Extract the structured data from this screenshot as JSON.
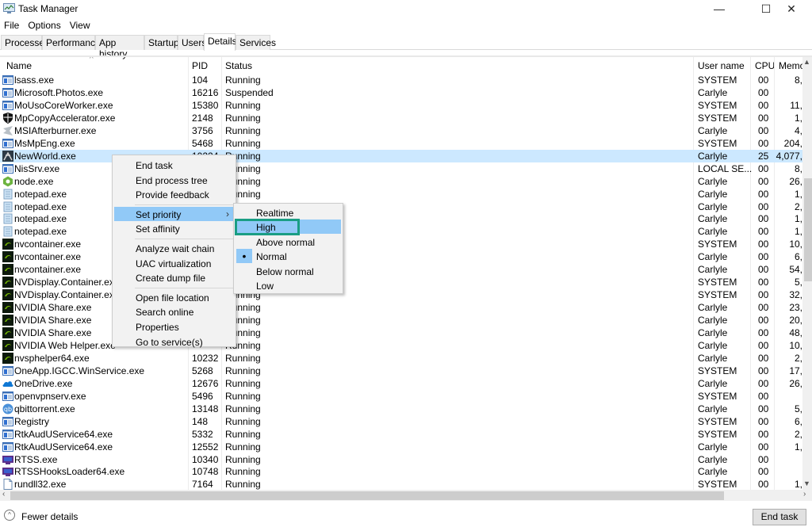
{
  "window": {
    "title": "Task Manager",
    "controls": {
      "minimize": "—",
      "maximize": "☐",
      "close": "✕"
    }
  },
  "menu": [
    "File",
    "Options",
    "View"
  ],
  "tabs": [
    {
      "label": "Processes"
    },
    {
      "label": "Performance"
    },
    {
      "label": "App history"
    },
    {
      "label": "Startup"
    },
    {
      "label": "Users"
    },
    {
      "label": "Details",
      "active": true
    },
    {
      "label": "Services"
    }
  ],
  "columns": {
    "name": "Name",
    "pid": "PID",
    "status": "Status",
    "user": "User name",
    "cpu": "CPU",
    "memory": "Memo"
  },
  "rows": [
    {
      "name": "lsass.exe",
      "icon": "service-window",
      "pid": "104",
      "status": "Running",
      "user": "SYSTEM",
      "cpu": "00",
      "mem": "8,"
    },
    {
      "name": "Microsoft.Photos.exe",
      "icon": "service-window",
      "pid": "16216",
      "status": "Suspended",
      "user": "Carlyle",
      "cpu": "00",
      "mem": ""
    },
    {
      "name": "MoUsoCoreWorker.exe",
      "icon": "service-window",
      "pid": "15380",
      "status": "Running",
      "user": "SYSTEM",
      "cpu": "00",
      "mem": "11,"
    },
    {
      "name": "MpCopyAccelerator.exe",
      "icon": "shield",
      "pid": "2148",
      "status": "Running",
      "user": "SYSTEM",
      "cpu": "00",
      "mem": "1,"
    },
    {
      "name": "MSIAfterburner.exe",
      "icon": "afterburner",
      "pid": "3756",
      "status": "Running",
      "user": "Carlyle",
      "cpu": "00",
      "mem": "4,"
    },
    {
      "name": "MsMpEng.exe",
      "icon": "service-window",
      "pid": "5468",
      "status": "Running",
      "user": "SYSTEM",
      "cpu": "00",
      "mem": "204,"
    },
    {
      "name": "NewWorld.exe",
      "icon": "newworld",
      "pid": "10224",
      "status": "Running",
      "user": "Carlyle",
      "cpu": "25",
      "mem": "4,077,",
      "selected": true
    },
    {
      "name": "NisSrv.exe",
      "icon": "service-window",
      "pid": "",
      "status": "Running",
      "user": "LOCAL SE...",
      "cpu": "00",
      "mem": "8,"
    },
    {
      "name": "node.exe",
      "icon": "node",
      "pid": "",
      "status": "Running",
      "user": "Carlyle",
      "cpu": "00",
      "mem": "26,"
    },
    {
      "name": "notepad.exe",
      "icon": "notepad",
      "pid": "",
      "status": "Running",
      "user": "Carlyle",
      "cpu": "00",
      "mem": "1,"
    },
    {
      "name": "notepad.exe",
      "icon": "notepad",
      "pid": "",
      "status": "Running",
      "user": "Carlyle",
      "cpu": "00",
      "mem": "2,"
    },
    {
      "name": "notepad.exe",
      "icon": "notepad",
      "pid": "",
      "status": "Running",
      "user": "Carlyle",
      "cpu": "00",
      "mem": "1,"
    },
    {
      "name": "notepad.exe",
      "icon": "notepad",
      "pid": "",
      "status": "Running",
      "user": "Carlyle",
      "cpu": "00",
      "mem": "1,"
    },
    {
      "name": "nvcontainer.exe",
      "icon": "nvidia",
      "pid": "",
      "status": "Running",
      "user": "SYSTEM",
      "cpu": "00",
      "mem": "10,"
    },
    {
      "name": "nvcontainer.exe",
      "icon": "nvidia",
      "pid": "",
      "status": "Running",
      "user": "Carlyle",
      "cpu": "00",
      "mem": "6,"
    },
    {
      "name": "nvcontainer.exe",
      "icon": "nvidia",
      "pid": "",
      "status": "Running",
      "user": "Carlyle",
      "cpu": "00",
      "mem": "54,"
    },
    {
      "name": "NVDisplay.Container.exe",
      "icon": "nvidia",
      "pid": "",
      "status": "Running",
      "user": "SYSTEM",
      "cpu": "00",
      "mem": "5,"
    },
    {
      "name": "NVDisplay.Container.exe",
      "icon": "nvidia",
      "pid": "",
      "status": "Running",
      "user": "SYSTEM",
      "cpu": "00",
      "mem": "32,"
    },
    {
      "name": "NVIDIA Share.exe",
      "icon": "nvidia",
      "pid": "",
      "status": "Running",
      "user": "Carlyle",
      "cpu": "00",
      "mem": "23,"
    },
    {
      "name": "NVIDIA Share.exe",
      "icon": "nvidia",
      "pid": "",
      "status": "Running",
      "user": "Carlyle",
      "cpu": "00",
      "mem": "20,"
    },
    {
      "name": "NVIDIA Share.exe",
      "icon": "nvidia",
      "pid": "",
      "status": "Running",
      "user": "Carlyle",
      "cpu": "00",
      "mem": "48,"
    },
    {
      "name": "NVIDIA Web Helper.exe",
      "icon": "nvidia",
      "pid": "",
      "status": "Running",
      "user": "Carlyle",
      "cpu": "00",
      "mem": "10,"
    },
    {
      "name": "nvsphelper64.exe",
      "icon": "nvidia",
      "pid": "10232",
      "status": "Running",
      "user": "Carlyle",
      "cpu": "00",
      "mem": "2,"
    },
    {
      "name": "OneApp.IGCC.WinService.exe",
      "icon": "service-window",
      "pid": "5268",
      "status": "Running",
      "user": "SYSTEM",
      "cpu": "00",
      "mem": "17,"
    },
    {
      "name": "OneDrive.exe",
      "icon": "onedrive",
      "pid": "12676",
      "status": "Running",
      "user": "Carlyle",
      "cpu": "00",
      "mem": "26,"
    },
    {
      "name": "openvpnserv.exe",
      "icon": "service-window",
      "pid": "5496",
      "status": "Running",
      "user": "SYSTEM",
      "cpu": "00",
      "mem": ""
    },
    {
      "name": "qbittorrent.exe",
      "icon": "qbittorrent",
      "pid": "13148",
      "status": "Running",
      "user": "Carlyle",
      "cpu": "00",
      "mem": "5,"
    },
    {
      "name": "Registry",
      "icon": "service-window",
      "pid": "148",
      "status": "Running",
      "user": "SYSTEM",
      "cpu": "00",
      "mem": "6,"
    },
    {
      "name": "RtkAudUService64.exe",
      "icon": "service-window",
      "pid": "5332",
      "status": "Running",
      "user": "SYSTEM",
      "cpu": "00",
      "mem": "2,"
    },
    {
      "name": "RtkAudUService64.exe",
      "icon": "service-window",
      "pid": "12552",
      "status": "Running",
      "user": "Carlyle",
      "cpu": "00",
      "mem": "1,"
    },
    {
      "name": "RTSS.exe",
      "icon": "rtss",
      "pid": "10340",
      "status": "Running",
      "user": "Carlyle",
      "cpu": "00",
      "mem": ""
    },
    {
      "name": "RTSSHooksLoader64.exe",
      "icon": "rtss",
      "pid": "10748",
      "status": "Running",
      "user": "Carlyle",
      "cpu": "00",
      "mem": ""
    },
    {
      "name": "rundll32.exe",
      "icon": "file",
      "pid": "7164",
      "status": "Running",
      "user": "SYSTEM",
      "cpu": "00",
      "mem": "1,"
    }
  ],
  "context_menu": {
    "items": [
      {
        "label": "End task"
      },
      {
        "label": "End process tree"
      },
      {
        "label": "Provide feedback"
      },
      {
        "separator": true
      },
      {
        "label": "Set priority",
        "submenu": true,
        "hover": true
      },
      {
        "label": "Set affinity"
      },
      {
        "separator": true
      },
      {
        "label": "Analyze wait chain"
      },
      {
        "label": "UAC virtualization"
      },
      {
        "label": "Create dump file"
      },
      {
        "separator": true
      },
      {
        "label": "Open file location"
      },
      {
        "label": "Search online"
      },
      {
        "label": "Properties"
      },
      {
        "label": "Go to service(s)"
      }
    ],
    "submenu_arrow": "›"
  },
  "priority_submenu": {
    "items": [
      {
        "label": "Realtime"
      },
      {
        "label": "High",
        "hover": true,
        "highlighted": true
      },
      {
        "label": "Above normal"
      },
      {
        "label": "Normal",
        "checked": true
      },
      {
        "label": "Below normal"
      },
      {
        "label": "Low"
      }
    ],
    "check_glyph": "•",
    "highlight_color": "#1a9e84"
  },
  "footer": {
    "fewer_details": "Fewer details",
    "end_task": "End task"
  },
  "colors": {
    "selection": "#cce8ff",
    "menu_hover": "#91c9f7",
    "annotation": "#1a9e84"
  }
}
